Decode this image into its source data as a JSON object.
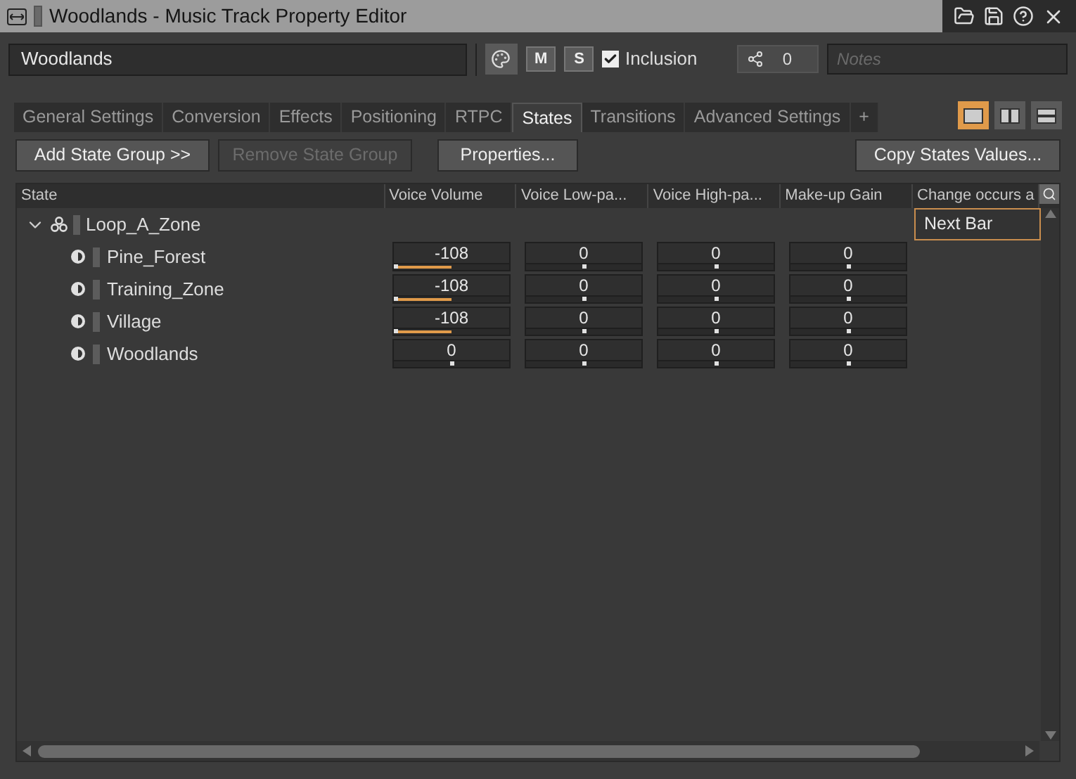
{
  "window": {
    "title": "Woodlands - Music Track Property Editor"
  },
  "toolbar": {
    "name": "Woodlands",
    "mute": "M",
    "solo": "S",
    "inclusion": {
      "label": "Inclusion",
      "checked": true
    },
    "share_count": "0",
    "notes": {
      "placeholder": "Notes"
    }
  },
  "tabs": [
    {
      "label": "General Settings",
      "selected": false
    },
    {
      "label": "Conversion",
      "selected": false
    },
    {
      "label": "Effects",
      "selected": false
    },
    {
      "label": "Positioning",
      "selected": false
    },
    {
      "label": "RTPC",
      "selected": false
    },
    {
      "label": "States",
      "selected": true
    },
    {
      "label": "Transitions",
      "selected": false
    },
    {
      "label": "Advanced Settings",
      "selected": false
    },
    {
      "label": "+",
      "selected": false
    }
  ],
  "layouts": [
    {
      "selected": true
    },
    {
      "selected": false
    },
    {
      "selected": false
    }
  ],
  "buttons": [
    {
      "label": "Add State Group >>",
      "disabled": false
    },
    {
      "label": "Remove State Group",
      "disabled": true
    },
    {
      "label": "Properties...",
      "disabled": false
    },
    {
      "label": "Copy States Values...",
      "disabled": false
    }
  ],
  "table": {
    "columns": [
      "State",
      "Voice Volume",
      "Voice Low-pa...",
      "Voice High-pa...",
      "Make-up Gain",
      "Change occurs a"
    ],
    "group": {
      "name": "Loop_A_Zone",
      "expanded": true,
      "change": "Next Bar",
      "children": [
        {
          "name": "Pine_Forest",
          "values": [
            {
              "text": "-108",
              "level": 0
            },
            {
              "text": "0",
              "level": 0.5
            },
            {
              "text": "0",
              "level": 0.5
            },
            {
              "text": "0",
              "level": 0.5
            }
          ]
        },
        {
          "name": "Training_Zone",
          "values": [
            {
              "text": "-108",
              "level": 0
            },
            {
              "text": "0",
              "level": 0.5
            },
            {
              "text": "0",
              "level": 0.5
            },
            {
              "text": "0",
              "level": 0.5
            }
          ]
        },
        {
          "name": "Village",
          "values": [
            {
              "text": "-108",
              "level": 0
            },
            {
              "text": "0",
              "level": 0.5
            },
            {
              "text": "0",
              "level": 0.5
            },
            {
              "text": "0",
              "level": 0.5
            }
          ]
        },
        {
          "name": "Woodlands",
          "values": [
            {
              "text": "0",
              "level": 0.5
            },
            {
              "text": "0",
              "level": 0.5
            },
            {
              "text": "0",
              "level": 0.5
            },
            {
              "text": "0",
              "level": 0.5
            }
          ]
        }
      ]
    }
  }
}
